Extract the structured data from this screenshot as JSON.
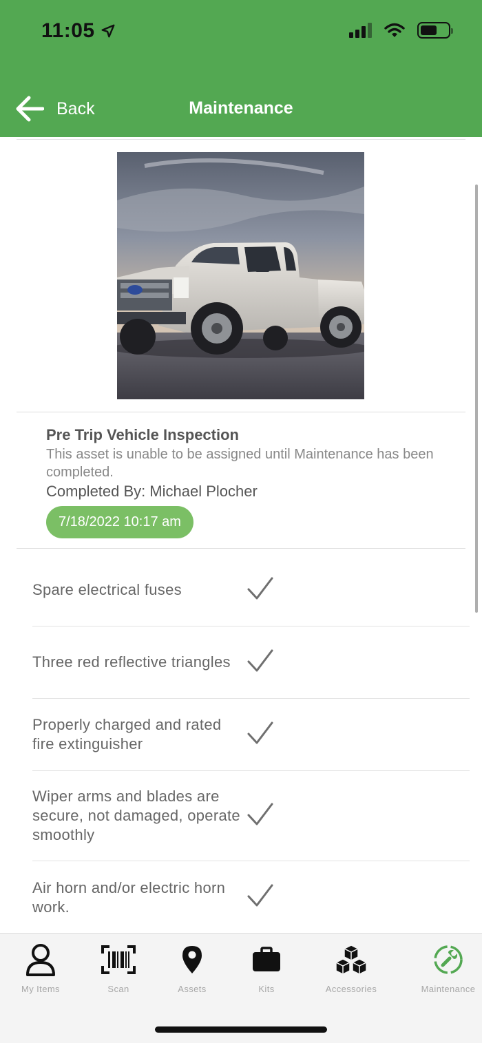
{
  "status_bar": {
    "time": "11:05"
  },
  "header": {
    "back_label": "Back",
    "title": "Maintenance"
  },
  "asset_photo": {
    "subject": "white pickup truck"
  },
  "inspection": {
    "title": "Pre Trip Vehicle Inspection",
    "message": "This asset is unable to be assigned until Maintenance has been completed.",
    "completed_by_label": "Completed By:",
    "completed_by_name": "Michael Plocher",
    "date": "7/18/2022 10:17 am"
  },
  "checklist": [
    {
      "label": "Spare electrical fuses",
      "checked": true
    },
    {
      "label": "Three red reflective triangles",
      "checked": true
    },
    {
      "label": "Properly charged and rated fire extinguisher",
      "checked": true
    },
    {
      "label": "Wiper arms and blades are secure, not damaged, operate smoothly",
      "checked": true
    },
    {
      "label": "Air horn and/or electric horn work.",
      "checked": true
    }
  ],
  "tabs": [
    {
      "label": "My Items",
      "icon": "person-icon",
      "active": false
    },
    {
      "label": "Scan",
      "icon": "barcode-icon",
      "active": false
    },
    {
      "label": "Assets",
      "icon": "map-pin-icon",
      "active": false
    },
    {
      "label": "Kits",
      "icon": "briefcase-icon",
      "active": false
    },
    {
      "label": "Accessories",
      "icon": "cubes-icon",
      "active": false
    },
    {
      "label": "Maintenance",
      "icon": "wrench-icon",
      "active": true
    }
  ],
  "colors": {
    "brand_green": "#53a852",
    "pill_green": "#7bbf65",
    "text_gray": "#666666",
    "tab_gray": "#a7a7a7"
  }
}
